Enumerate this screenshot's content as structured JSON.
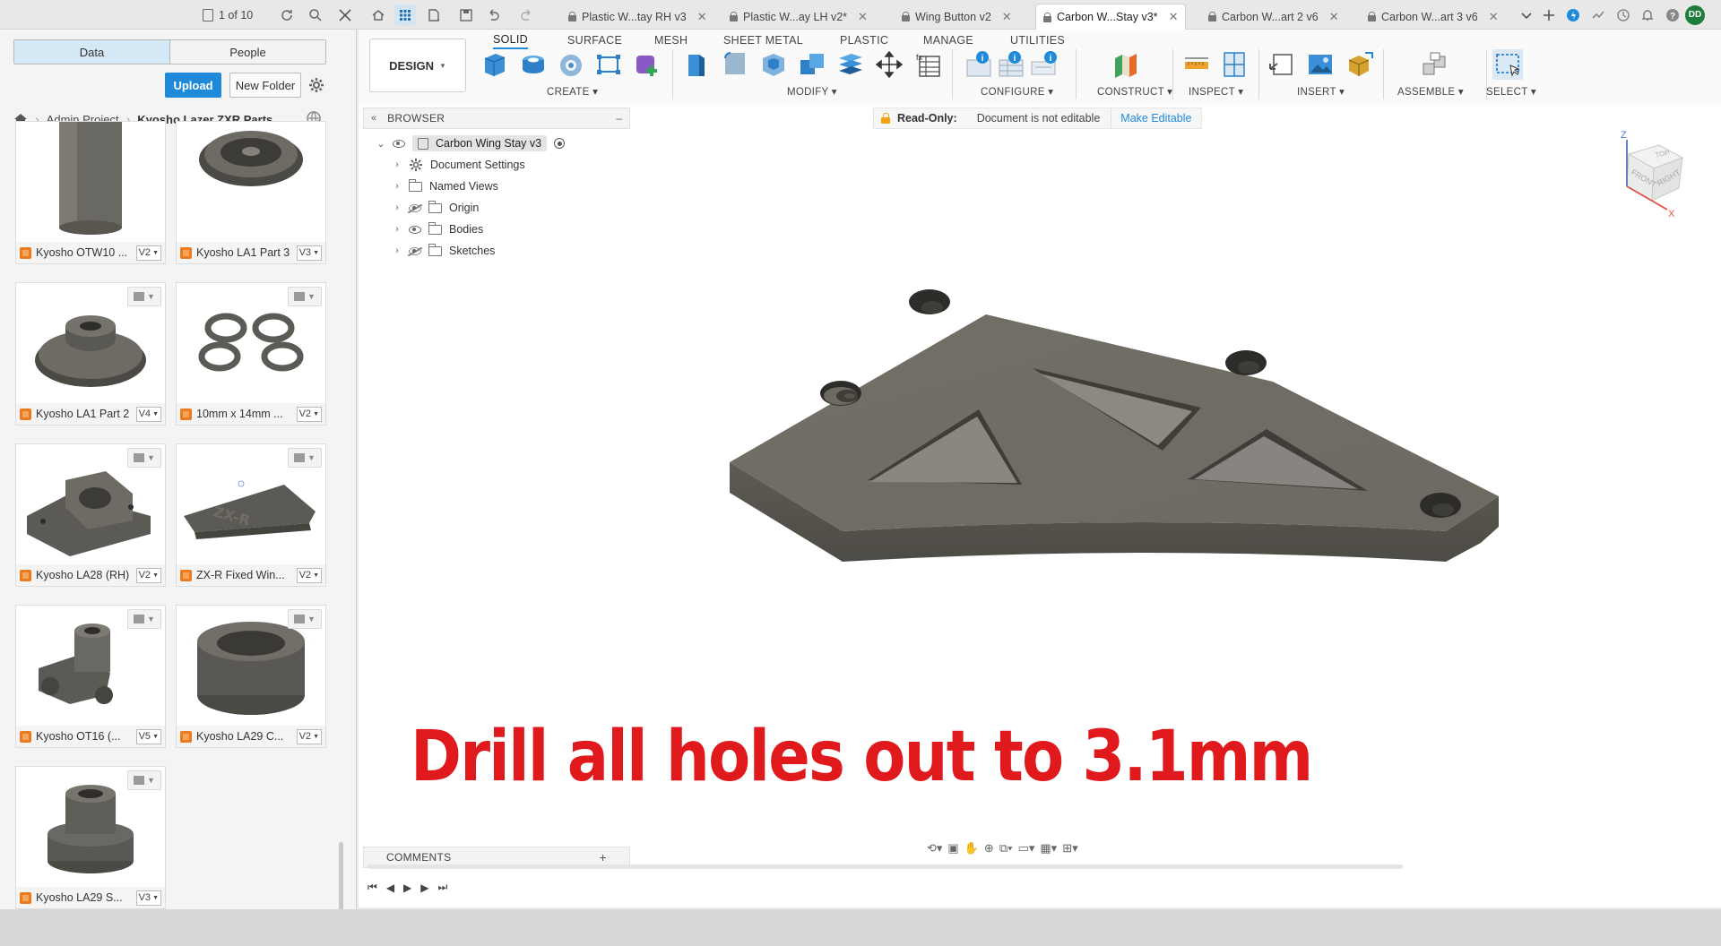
{
  "topbar": {
    "page_counter": "1 of 10",
    "tabs": [
      {
        "label": "Plastic W...tay RH v3",
        "active": false
      },
      {
        "label": "Plastic W...ay LH v2*",
        "active": false
      },
      {
        "label": "Wing Button v2",
        "active": false
      },
      {
        "label": "Carbon W...Stay v3*",
        "active": true
      },
      {
        "label": "Carbon W...art 2 v6",
        "active": false
      },
      {
        "label": "Carbon W...art 3 v6",
        "active": false
      }
    ],
    "avatar_initials": "DD",
    "colors": {
      "avatar": "#1e7d3a",
      "accent": "#1f8ad9"
    }
  },
  "data_panel": {
    "tabs": [
      "Data",
      "People"
    ],
    "active_tab": "Data",
    "upload_label": "Upload",
    "new_folder_label": "New Folder",
    "breadcrumb": {
      "project": "Admin Project",
      "folder": "Kyosho Lazer ZXR Parts"
    },
    "files": [
      {
        "name": "Kyosho OTW10 ...",
        "version": "V2",
        "thumb": "cylinder-tall"
      },
      {
        "name": "Kyosho LA1 Part 3",
        "version": "V3",
        "thumb": "pulley"
      },
      {
        "name": "Kyosho LA1 Part 2",
        "version": "V4",
        "thumb": "flange-hub"
      },
      {
        "name": "10mm x 14mm ...",
        "version": "V2",
        "thumb": "rings"
      },
      {
        "name": "Kyosho LA28 (RH)",
        "version": "V2",
        "thumb": "bracket"
      },
      {
        "name": "ZX-R Fixed Win...",
        "version": "V2",
        "thumb": "wing"
      },
      {
        "name": "Kyosho OT16 (...",
        "version": "V5",
        "thumb": "knuckle"
      },
      {
        "name": "Kyosho LA29 C...",
        "version": "V2",
        "thumb": "bushing-wide"
      },
      {
        "name": "Kyosho LA29 S...",
        "version": "V3",
        "thumb": "stepped-bushing"
      }
    ]
  },
  "toolbar": {
    "design_label": "DESIGN",
    "tabs": [
      "SOLID",
      "SURFACE",
      "MESH",
      "SHEET METAL",
      "PLASTIC",
      "MANAGE",
      "UTILITIES"
    ],
    "active_tab": "SOLID",
    "groups": [
      "CREATE",
      "MODIFY",
      "CONFIGURE",
      "CONSTRUCT",
      "INSPECT",
      "INSERT",
      "ASSEMBLE",
      "SELECT"
    ]
  },
  "browser": {
    "title": "BROWSER",
    "root": "Carbon Wing Stay v3",
    "items": [
      "Document Settings",
      "Named Views",
      "Origin",
      "Bodies",
      "Sketches"
    ]
  },
  "readonly_banner": {
    "label": "Read-Only:",
    "message": "Document is not editable",
    "action": "Make Editable"
  },
  "viewcube": {
    "faces": [
      "TOP",
      "FRONT",
      "RIGHT"
    ],
    "axes": [
      "Z",
      "X"
    ]
  },
  "overlay_caption": "Drill all holes out to 3.1mm",
  "comments_label": "COMMENTS"
}
